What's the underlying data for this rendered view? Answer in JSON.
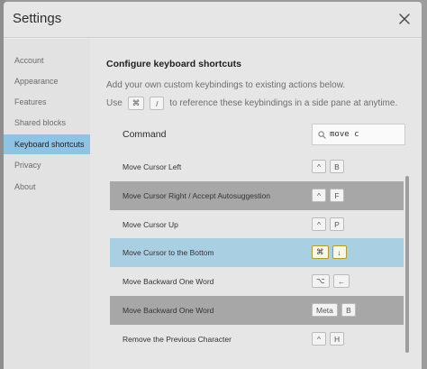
{
  "window": {
    "title": "Settings"
  },
  "sidebar": {
    "items": [
      {
        "label": "Account",
        "active": false
      },
      {
        "label": "Appearance",
        "active": false
      },
      {
        "label": "Features",
        "active": false
      },
      {
        "label": "Shared blocks",
        "active": false
      },
      {
        "label": "Keyboard shortcuts",
        "active": true
      },
      {
        "label": "Privacy",
        "active": false
      },
      {
        "label": "About",
        "active": false
      }
    ]
  },
  "main": {
    "section_title": "Configure keyboard shortcuts",
    "description_line1": "Add your own custom keybindings to existing actions below.",
    "description_use": "Use",
    "description_keys": [
      "⌘",
      "/"
    ],
    "description_rest": "to reference these keybindings in a side pane at anytime.",
    "command_header": "Command",
    "search": {
      "value": "move c",
      "icon": "search-icon"
    },
    "rows": [
      {
        "label": "Move Cursor Left",
        "keys": [
          "^",
          "B"
        ],
        "state": "normal"
      },
      {
        "label": "Move Cursor Right / Accept Autosuggestion",
        "keys": [
          "^",
          "F"
        ],
        "state": "dark"
      },
      {
        "label": "Move Cursor Up",
        "keys": [
          "^",
          "P"
        ],
        "state": "normal"
      },
      {
        "label": "Move Cursor to the Bottom",
        "keys": [
          "⌘",
          "↓"
        ],
        "state": "selected"
      },
      {
        "label": "Move Backward One Word",
        "keys": [
          "⌥",
          "←"
        ],
        "state": "normal"
      },
      {
        "label": "Move Backward One Word",
        "keys": [
          "Meta",
          "B"
        ],
        "state": "dark"
      },
      {
        "label": "Remove the Previous Character",
        "keys": [
          "^",
          "H"
        ],
        "state": "normal"
      }
    ]
  },
  "colors": {
    "selected_row": "#a9cfe2",
    "active_sidebar": "#8fc3e3",
    "dark_row": "#a7a7a7",
    "selected_key_border": "#b19b35"
  }
}
